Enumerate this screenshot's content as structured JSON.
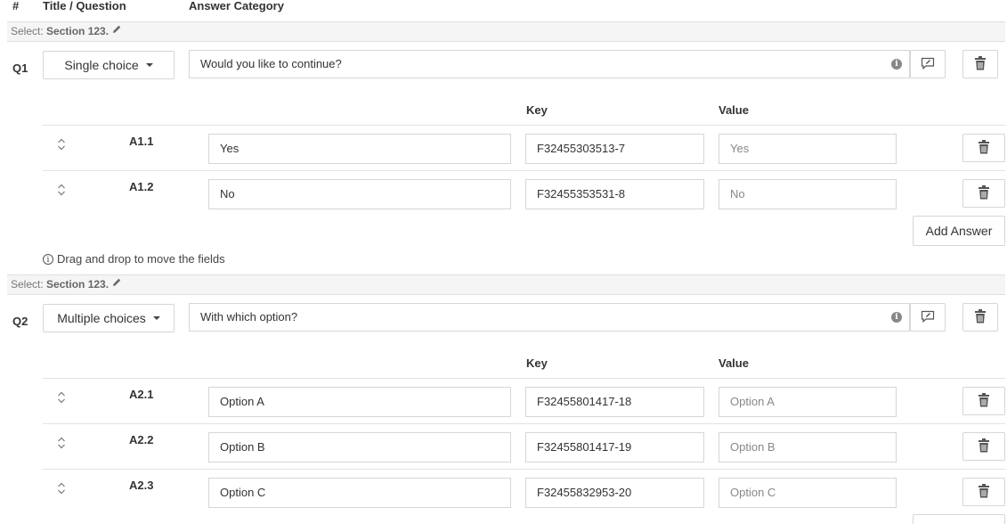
{
  "header": {
    "num": "#",
    "title": "Title / Question",
    "category": "Answer Category"
  },
  "columns": {
    "key": "Key",
    "value": "Value"
  },
  "hint": "Drag and drop to move the fields",
  "add_answer_label": "Add Answer",
  "questions": [
    {
      "section_prefix": "Select:",
      "section_name": "Section 123.",
      "num": "Q1",
      "type": "Single choice",
      "text": "Would you like to continue?",
      "answers": [
        {
          "label": "A1.1",
          "text": "Yes",
          "key": "F32455303513-7",
          "value": "Yes"
        },
        {
          "label": "A1.2",
          "text": "No",
          "key": "F32455353531-8",
          "value": "No"
        }
      ]
    },
    {
      "section_prefix": "Select:",
      "section_name": "Section 123.",
      "num": "Q2",
      "type": "Multiple choices",
      "text": "With which option?",
      "answers": [
        {
          "label": "A2.1",
          "text": "Option A",
          "key": "F32455801417-18",
          "value": "Option A"
        },
        {
          "label": "A2.2",
          "text": "Option B",
          "key": "F32455801417-19",
          "value": "Option B"
        },
        {
          "label": "A2.3",
          "text": "Option C",
          "key": "F32455832953-20",
          "value": "Option C"
        }
      ]
    }
  ]
}
